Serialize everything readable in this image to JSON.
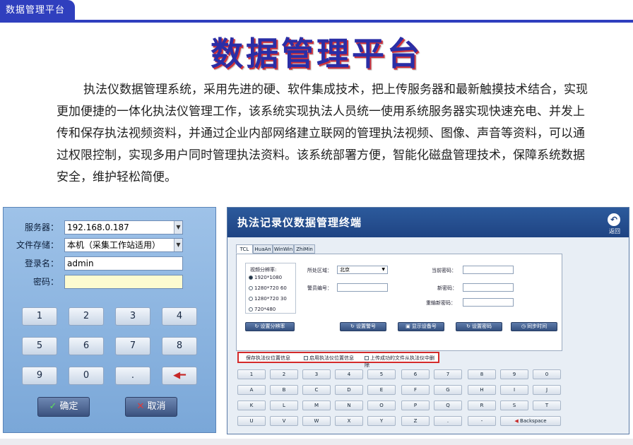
{
  "header": {
    "tab_label": "数据管理平台"
  },
  "title": "数据管理平台",
  "intro": "执法仪数据管理系统，采用先进的硬、软件集成技术，把上传服务器和最新触摸技术结合，实现更加便捷的一体化执法仪管理工作，该系统实现执法人员统一使用系统服务器实现快速充电、并发上传和保存执法视频资料，并通过企业内部网络建立联网的管理执法视频、图像、声音等资料，可以通过权限控制，实现多用户同时管理执法资料。该系统部署方便，智能化磁盘管理技术，保障系统数据安全，维护轻松简便。",
  "login": {
    "server_label": "服务器：",
    "server_value": "192.168.0.187",
    "storage_label": "文件存储：",
    "storage_value": "本机（采集工作站适用）",
    "user_label": "登录名：",
    "user_value": "admin",
    "password_label": "密码：",
    "password_value": "",
    "keys": [
      "1",
      "2",
      "3",
      "4",
      "5",
      "6",
      "7",
      "8",
      "9",
      "0",
      "."
    ],
    "backspace_icon": "left-arrow-icon",
    "ok_label": "确定",
    "cancel_label": "取消"
  },
  "terminal": {
    "title": "执法记录仪数据管理终端",
    "back_label": "返回",
    "tabs": [
      "TCL",
      "HuaAn",
      "WinWin",
      "ZhiMin"
    ],
    "resolution_label": "视频分辨率:",
    "resolutions": [
      "1920*1080",
      "1280*720 60",
      "1280*720 30",
      "720*480"
    ],
    "area_label": "所处区域：",
    "area_value": "北京",
    "police_label": "警员编号：",
    "current_pwd_label": "当前密码：",
    "new_pwd_label": "新密码：",
    "confirm_pwd_label": "重输新密码：",
    "btn_resolution": "设置分辨率",
    "btn_police": "设置警号",
    "btn_show_device": "显示设备号",
    "btn_set_pwd": "设置密码",
    "btn_sync_time": "同步时间",
    "chk_save_location": "保存执法仪位置信息",
    "chk_enable_location": "启用执法仪位置信息",
    "chk_delete_uploaded": "上传成功的文件从执法仪中删除",
    "keyrow1": [
      "1",
      "2",
      "3",
      "4",
      "5",
      "6",
      "7",
      "8",
      "9",
      "0"
    ],
    "keyrow2": [
      "A",
      "B",
      "C",
      "D",
      "E",
      "F",
      "G",
      "H",
      "I",
      "J"
    ],
    "keyrow3": [
      "K",
      "L",
      "M",
      "N",
      "O",
      "P",
      "Q",
      "R",
      "S",
      "T"
    ],
    "keyrow4": [
      "U",
      "V",
      "W",
      "X",
      "Y",
      "Z",
      ".",
      "-"
    ],
    "backspace_label": "Backspace"
  }
}
